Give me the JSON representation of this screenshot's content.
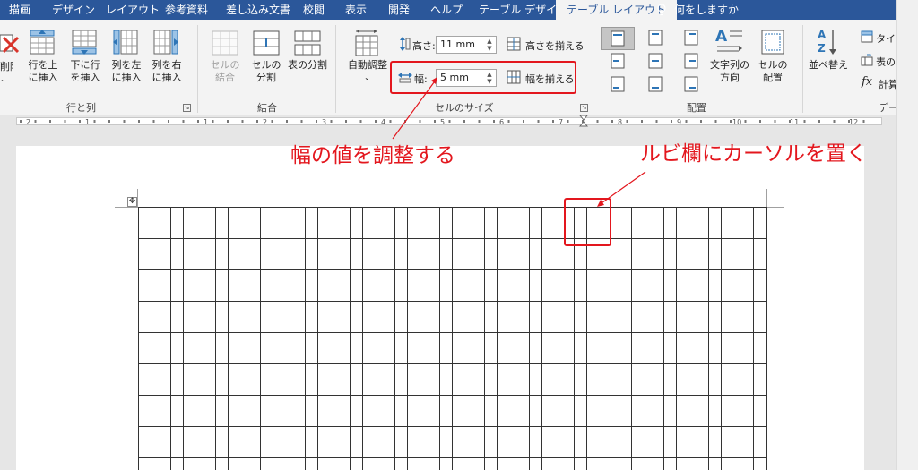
{
  "tabs": [
    "描画",
    "デザイン",
    "レイアウト",
    "参考資料",
    "差し込み文書",
    "校閲",
    "表示",
    "開発",
    "ヘルプ",
    "テーブル デザイン",
    "テーブル レイアウト"
  ],
  "tell_me": "何をしますか",
  "ribbon": {
    "rows_cols": {
      "delete_label": "削除",
      "insert_above": [
        "行を上",
        "に挿入"
      ],
      "insert_below": [
        "下に行",
        "を挿入"
      ],
      "insert_left": [
        "列を左",
        "に挿入"
      ],
      "insert_right": [
        "列を右",
        "に挿入"
      ],
      "group_label": "行と列"
    },
    "merge": {
      "merge_cells": [
        "セルの",
        "結合"
      ],
      "split_cells": [
        "セルの",
        "分割"
      ],
      "split_table": "表の分割",
      "group_label": "結合"
    },
    "cell_size": {
      "autofit": "自動調整",
      "height_label": "高さ:",
      "height_value": "11 mm",
      "distribute_rows": "高さを揃える",
      "width_label": "幅:",
      "width_value": "5 mm",
      "distribute_cols": "幅を揃える",
      "group_label": "セルのサイズ"
    },
    "alignment": {
      "text_direction": [
        "文字列の",
        "方向"
      ],
      "cell_margins": [
        "セルの",
        "配置"
      ],
      "group_label": "配置"
    },
    "data": {
      "sort": "並べ替え",
      "repeat_header": "タイト",
      "convert_to_text": "表の",
      "formula": "計算",
      "group_label": "デー"
    }
  },
  "ruler_numbers": [
    "2",
    "1",
    "1",
    "2",
    "3",
    "4",
    "5",
    "6",
    "7",
    "8",
    "9",
    "10",
    "11",
    "12"
  ],
  "callouts": {
    "width": "幅の値を調整する",
    "cursor": "ルビ欄にカーソルを置く"
  },
  "colors": {
    "tabbar": "#2b579a",
    "callout": "#e3171e",
    "ribbon_bg": "#f3f3f3"
  }
}
